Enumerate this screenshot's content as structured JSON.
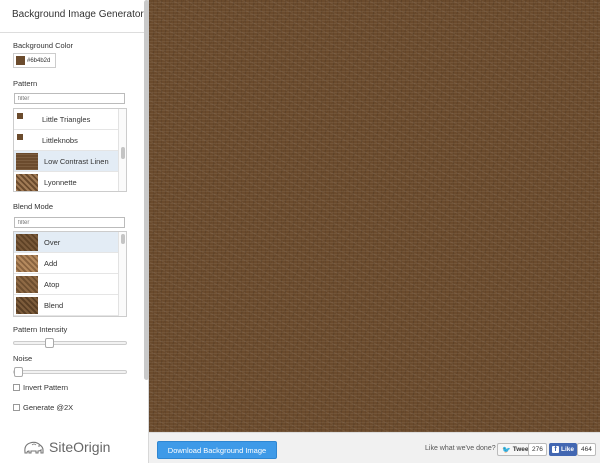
{
  "app": {
    "title": "Background Image Generator"
  },
  "background_color": {
    "label": "Background Color",
    "value": "#6b4b2d",
    "swatch": "#6b4b2d"
  },
  "pattern": {
    "label": "Pattern",
    "filter_placeholder": "filter",
    "items": [
      {
        "name": "Little Triangles"
      },
      {
        "name": "Littleknobs"
      },
      {
        "name": "Low Contrast Linen",
        "selected": true
      },
      {
        "name": "Lyonnette"
      }
    ]
  },
  "blend_mode": {
    "label": "Blend Mode",
    "filter_placeholder": "filter",
    "items": [
      {
        "name": "Over",
        "selected": true
      },
      {
        "name": "Add"
      },
      {
        "name": "Atop"
      },
      {
        "name": "Blend"
      }
    ]
  },
  "pattern_intensity": {
    "label": "Pattern Intensity",
    "value": 0.3
  },
  "noise": {
    "label": "Noise",
    "value": 0.0
  },
  "options": {
    "invert_pattern": {
      "label": "Invert Pattern",
      "checked": false
    },
    "generate_2x": {
      "label": "Generate @2X",
      "checked": false
    }
  },
  "logo": {
    "text": "SiteOrigin"
  },
  "footer": {
    "download_label": "Download Background Image",
    "like_prompt": "Like what we've done?",
    "tweet_label": "Tweet",
    "tweet_count": "276",
    "like_label": "Like",
    "like_count": "464"
  },
  "colors": {
    "accent": "#3e9ae8",
    "facebook": "#4267b2",
    "twitter": "#2aa3ef",
    "preview_base": "#6b4b2d"
  }
}
